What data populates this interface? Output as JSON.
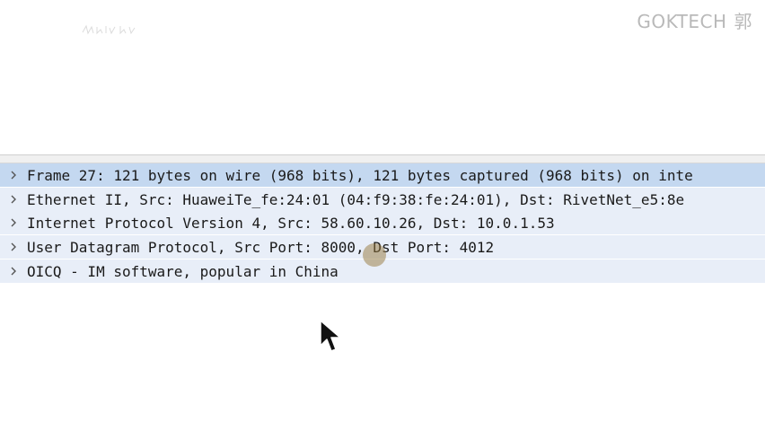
{
  "watermark": {
    "brand": "GOKTECH",
    "glyph": "郭"
  },
  "packet_details": {
    "rows": [
      {
        "label": "Frame 27: 121 bytes on wire (968 bits), 121 bytes captured (968 bits) on inte",
        "expand_icon": "chevron-right-icon"
      },
      {
        "label": "Ethernet II, Src: HuaweiTe_fe:24:01 (04:f9:38:fe:24:01), Dst: RivetNet_e5:8e",
        "expand_icon": "chevron-right-icon"
      },
      {
        "label": "Internet Protocol Version 4, Src: 58.60.10.26, Dst: 10.0.1.53",
        "expand_icon": "chevron-right-icon"
      },
      {
        "label": "User Datagram Protocol, Src Port: 8000, Dst Port: 4012",
        "expand_icon": "chevron-right-icon"
      },
      {
        "label": "OICQ - IM software, popular in China",
        "expand_icon": "chevron-right-icon"
      }
    ],
    "selected_index": 0
  },
  "colors": {
    "row_bg": "#e8eef8",
    "selected_row_bg": "#c4d8f0",
    "text": "#1a1a1a",
    "watermark": "#b9b9b9"
  },
  "cursor_icon": "arrow-cursor-icon"
}
